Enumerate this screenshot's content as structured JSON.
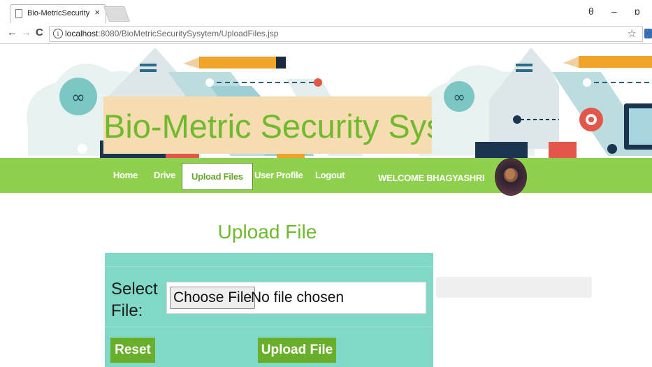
{
  "browser": {
    "tab_title": "Bio-MetricSecuritySystem",
    "tab_close": "×",
    "url_host": "localhost",
    "url_path": ":8080/BioMetricSecuritySysytem/UploadFiles.jsp",
    "info_glyph": "i",
    "back_glyph": "←",
    "forward_glyph": "→",
    "reload_glyph": "C",
    "star_glyph": "☆",
    "account_glyph": "θ",
    "minimize_glyph": "–",
    "restore_glyph": "ɒ"
  },
  "banner": {
    "title": "Bio-Metric Security System"
  },
  "nav": {
    "items": [
      {
        "label": "Home"
      },
      {
        "label": "Drive"
      },
      {
        "label": "Upload Files"
      },
      {
        "label": "User Profile"
      },
      {
        "label": "Logout"
      }
    ],
    "welcome": "WELCOME BHAGYASHRI"
  },
  "main": {
    "heading": "Upload File",
    "select_label": "Select File:",
    "choose_button": "Choose File",
    "no_file_text": "No file chosen",
    "reset_button": "Reset",
    "upload_button": "Upload File"
  },
  "colors": {
    "accent_green": "#8fd14f",
    "title_green": "#6fba2c",
    "panel_teal": "#7fd9c6",
    "title_bg": "#f5dcb1"
  }
}
